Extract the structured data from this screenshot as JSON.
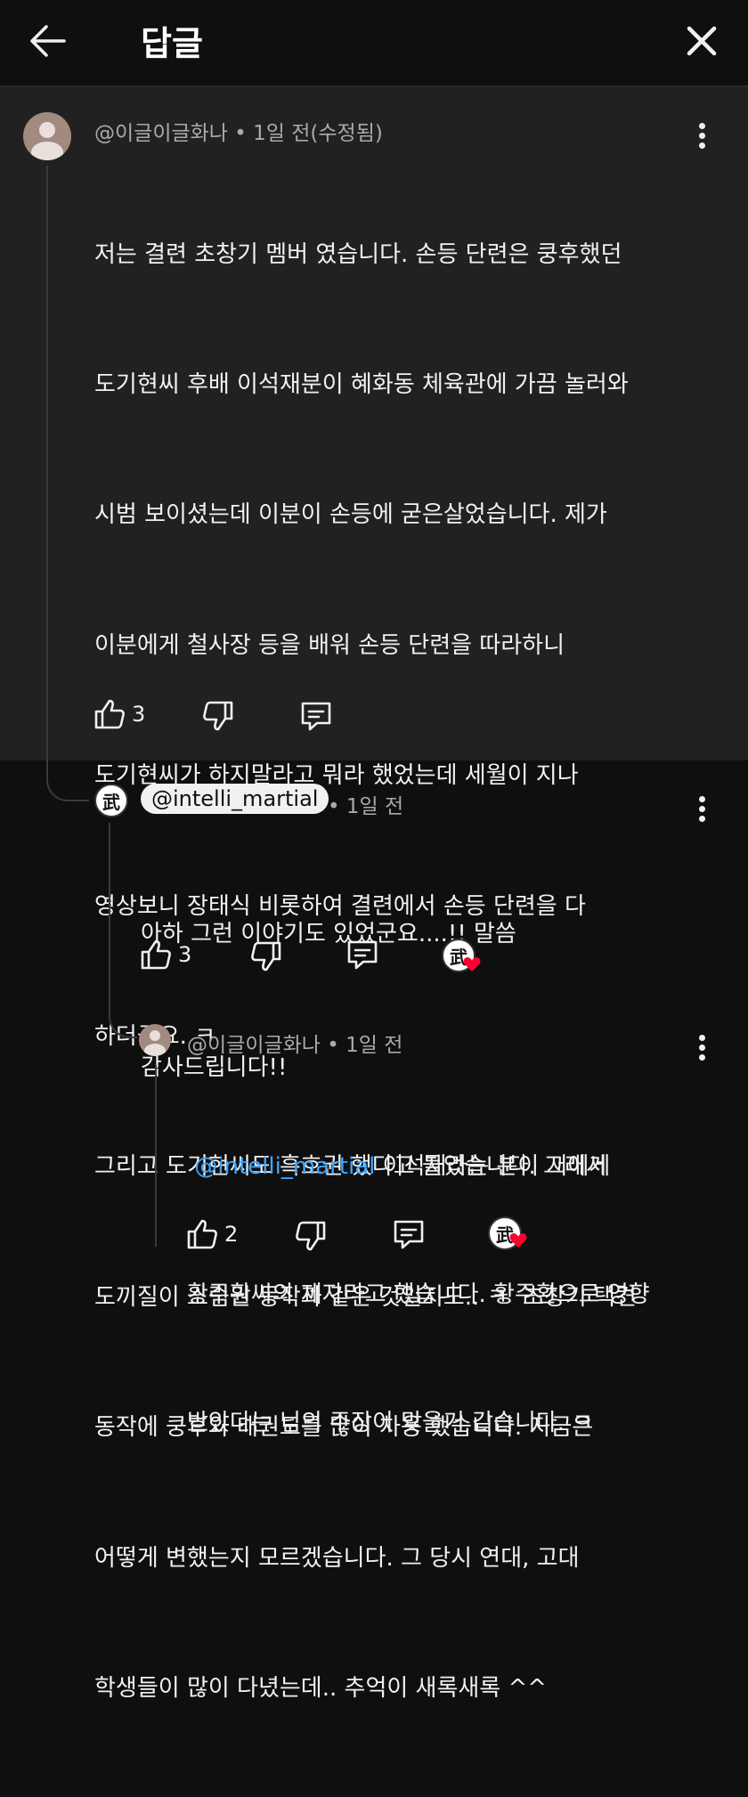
{
  "header": {
    "title": "답글",
    "back_icon": "arrow-left-icon",
    "close_icon": "close-icon"
  },
  "comments": [
    {
      "author": "@이글이글화나",
      "meta": "@이글이글화나 • 1일 전(수정됨)",
      "lines": [
        "저는 결련 초창기 멤버 였습니다. 손등 단련은 쿵후했던",
        "도기현씨 후배 이석재분이 혜화동 체육관에 가끔 놀러와",
        "시범 보이셨는데 이분이 손등에 굳은살었습니다. 제가",
        "이분에게 철사장 등을 배워 손등 단련을 따라하니",
        "도기현씨가 하지말라고 뭐라 했었는데 세월이 지나",
        "영상보니 장태식 비롯하여 결련에서 손등 단련을 다",
        "하더군요. ㅋ",
        "그리고 도기현씨도 흑호권 했다고 들었습니다. 그래서",
        "도끼질이 소림권 동작과 같은 것일지도.. ㅋ  초창기 택견",
        "동작에 쿵후와 태권도를 많이 차용 했습니다. 지금은",
        "어떻게 변했는지 모르겠습니다. 그 당시 연대, 고대",
        "학생들이 많이 다녔는데.. 추억이 새록새록 ^^"
      ],
      "likes": "3"
    },
    {
      "author": "@intelli_martial",
      "time": "• 1일 전",
      "avatar_char": "武",
      "lines": [
        "아하 그런 이야기도 있었군요....!! 말씀",
        "감사드립니다!!"
      ],
      "likes": "3"
    },
    {
      "author": "@이글이글화나",
      "meta": "@이글이글화나 • 1일 전",
      "mention": "@intelli_martial",
      "line1_rest": " 이석재라는 분이 저에게",
      "lines": [
        "황주환씨의 제자라고 했습니다. 황주환으로 영향",
        "받았다는 님의 주장이 맞을거 같습니다. ㅋ"
      ],
      "likes": "2"
    }
  ],
  "icons": {
    "like": "thumbs-up-icon",
    "dislike": "thumbs-down-icon",
    "reply": "reply-comment-icon",
    "more": "more-vertical-icon",
    "creator_heart": "creator-heart-icon"
  },
  "colors": {
    "background": "#0f0f0f",
    "highlight": "#212121",
    "mention": "#3ea6ff",
    "meta": "#aaaaaa",
    "heart": "#ff0033"
  }
}
